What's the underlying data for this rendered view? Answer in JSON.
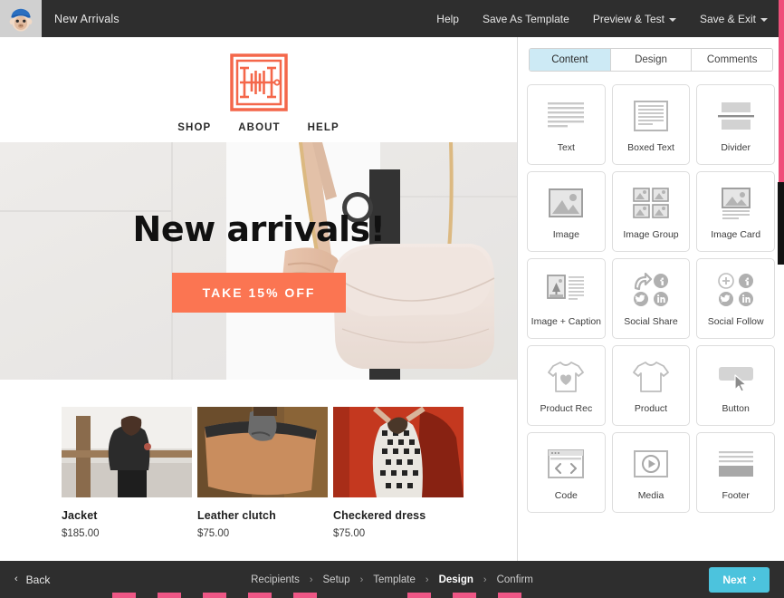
{
  "topbar": {
    "logo_icon": "mailchimp-freddie-icon",
    "campaign_title": "New Arrivals",
    "nav": [
      {
        "label": "Help",
        "caret": false
      },
      {
        "label": "Save As Template",
        "caret": false
      },
      {
        "label": "Preview & Test",
        "caret": true
      },
      {
        "label": "Save & Exit",
        "caret": true
      }
    ]
  },
  "email": {
    "logo_icon": "brand-square-logo-icon",
    "nav": [
      "SHOP",
      "ABOUT",
      "HELP"
    ],
    "hero": {
      "title": "New arrivals!",
      "cta_label": "TAKE 15% OFF",
      "cta_color": "#fb7552",
      "image_alt": "woman-with-white-handbag"
    },
    "products": [
      {
        "name": "Jacket",
        "price": "$185.00",
        "image_alt": "woman-in-black-leather-jacket"
      },
      {
        "name": "Leather clutch",
        "price": "$75.00",
        "image_alt": "tan-leather-clutch-bag"
      },
      {
        "name": "Checkered dress",
        "price": "$75.00",
        "image_alt": "woman-in-checkered-dress-orange-wall"
      }
    ]
  },
  "panel": {
    "tabs": [
      {
        "label": "Content",
        "active": true
      },
      {
        "label": "Design",
        "active": false
      },
      {
        "label": "Comments",
        "active": false
      }
    ],
    "active_tab_color": "#cdeaf5",
    "blocks": [
      {
        "label": "Text",
        "icon": "text-lines-icon"
      },
      {
        "label": "Boxed Text",
        "icon": "boxed-text-icon"
      },
      {
        "label": "Divider",
        "icon": "divider-icon"
      },
      {
        "label": "Image",
        "icon": "image-icon"
      },
      {
        "label": "Image Group",
        "icon": "image-group-icon"
      },
      {
        "label": "Image Card",
        "icon": "image-card-icon"
      },
      {
        "label": "Image + Caption",
        "icon": "image-caption-icon"
      },
      {
        "label": "Social Share",
        "icon": "social-share-icon"
      },
      {
        "label": "Social Follow",
        "icon": "social-follow-icon"
      },
      {
        "label": "Product Rec",
        "icon": "tshirt-heart-icon"
      },
      {
        "label": "Product",
        "icon": "tshirt-icon"
      },
      {
        "label": "Button",
        "icon": "button-cursor-icon"
      },
      {
        "label": "Code",
        "icon": "code-brackets-icon"
      },
      {
        "label": "Media",
        "icon": "media-play-icon"
      },
      {
        "label": "Footer",
        "icon": "footer-icon"
      }
    ]
  },
  "bottombar": {
    "back_label": "Back",
    "next_label": "Next",
    "next_color": "#4cc3dd",
    "steps": [
      {
        "label": "Recipients",
        "current": false
      },
      {
        "label": "Setup",
        "current": false
      },
      {
        "label": "Template",
        "current": false
      },
      {
        "label": "Design",
        "current": true
      },
      {
        "label": "Confirm",
        "current": false
      }
    ],
    "step_separator": "›"
  }
}
